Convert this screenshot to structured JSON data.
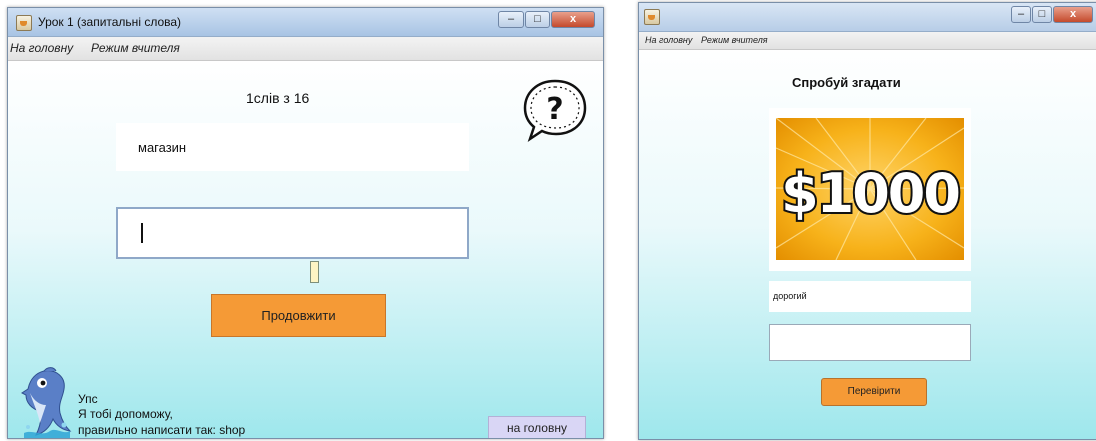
{
  "left_window": {
    "title": "Урок 1 (запитальні слова)",
    "controls": [
      "–",
      "□",
      "x"
    ],
    "menu": [
      "На головну",
      "Режим вчителя"
    ],
    "counter": "1слів з 16",
    "word": "магазин",
    "answer_value": "",
    "continue_label": "Продовжити",
    "help_lines": [
      "Упс",
      "Я тобі допоможу,",
      "правильно написати так: shop"
    ],
    "home_label": "на головну",
    "accent": "#f59a36",
    "help_icon_glyph": "?"
  },
  "right_window": {
    "title": "",
    "controls": [
      "–",
      "□",
      "x"
    ],
    "menu": [
      "На головну",
      "Режим вчителя"
    ],
    "heading": "Спробуй згадати",
    "image_text": "$1000",
    "word": "дорогий",
    "answer_value": "",
    "check_label": "Перевірити",
    "accent": "#f59a36"
  }
}
